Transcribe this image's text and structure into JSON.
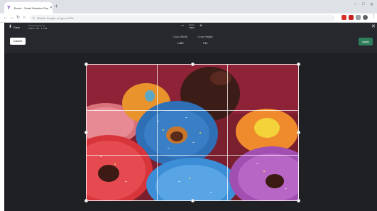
{
  "browser": {
    "tab_title": "Brush · Small Notation Display",
    "new_tab_symbol": "+",
    "omnibox_placeholder": "Search Google or type a URL",
    "window_controls": [
      "–",
      "□",
      "✕"
    ]
  },
  "app": {
    "save_label": "Save",
    "file_name": "brush-donuts.png",
    "file_dims": "1480 × 742 · 1.1 kB",
    "zoom_label": "Zoom",
    "zoom_value": "100%",
    "zoom_out": "−",
    "zoom_in": "+",
    "close_symbol": "✕",
    "cancel_label": "Cancel",
    "crop_width_label": "Crop Width",
    "crop_width_value": "1480",
    "crop_height_label": "Crop Height",
    "crop_height_value": "742",
    "apply_label": "Apply"
  },
  "image_subject": "frosted donuts with sprinkles",
  "colors": {
    "app_bg": "#1f2024",
    "toolbar_bg": "#26282d",
    "apply": "#2e7d5b",
    "photo_bg": "#7a1f2e"
  },
  "icons": {
    "save": "save-icon",
    "back": "back-arrow-icon",
    "forward": "forward-arrow-icon",
    "reload": "reload-icon",
    "home": "home-icon",
    "menu": "kebab-menu-icon"
  }
}
